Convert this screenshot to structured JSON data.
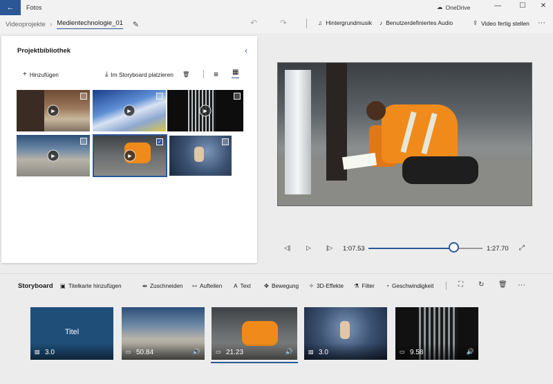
{
  "titlebar": {
    "app_title": "Fotos",
    "onedrive_label": "OneDrive",
    "minimize": "—",
    "maximize": "☐",
    "close": "✕",
    "back_icon": "←"
  },
  "navbar": {
    "breadcrumb_root": "Videoprojekte",
    "breadcrumb_separator": "›",
    "project_name": "Medientechnologie_01",
    "undo_icon": "↶",
    "redo_icon": "↷",
    "background_music": "Hintergrundmusik",
    "custom_audio": "Benutzerdefiniertes Audio",
    "finish_video": "Video fertig stellen",
    "more": "···"
  },
  "library": {
    "title": "Projektbibliothek",
    "collapse_icon": "‹",
    "add_label": "Hinzufügen",
    "place_in_storyboard": "Im Storyboard platzieren",
    "thumbnails": [
      {
        "kind": "video",
        "scene": "street-door",
        "selected": false
      },
      {
        "kind": "video",
        "scene": "blue-blur",
        "selected": false
      },
      {
        "kind": "video",
        "scene": "dark-gate",
        "selected": false
      },
      {
        "kind": "video",
        "scene": "stairs",
        "selected": false
      },
      {
        "kind": "video",
        "scene": "workers",
        "selected": true
      },
      {
        "kind": "image",
        "scene": "skater",
        "selected": false
      }
    ]
  },
  "playback": {
    "current_time": "1:07.53",
    "total_time": "1:27.70",
    "progress_fraction": 0.748
  },
  "storyboard": {
    "title": "Storyboard",
    "tools": {
      "title_card": "Titelkarte hinzufügen",
      "trim": "Zuschneiden",
      "split": "Aufteilen",
      "text": "Text",
      "motion": "Bewegung",
      "effects_3d": "3D-Effekte",
      "filters": "Filter",
      "speed": "Geschwindigkeit",
      "more": "···"
    },
    "clips": [
      {
        "kind": "title-card",
        "text": "Titel",
        "duration": "3.0",
        "audio": false,
        "selected": false
      },
      {
        "kind": "video",
        "duration": "50.84",
        "audio": true,
        "selected": false
      },
      {
        "kind": "video",
        "duration": "21.23",
        "audio": true,
        "selected": true
      },
      {
        "kind": "image",
        "duration": "3.0",
        "audio": false,
        "selected": false
      },
      {
        "kind": "video",
        "duration": "9.58",
        "audio": true,
        "selected": false
      }
    ]
  },
  "colors": {
    "accent": "#2b5797",
    "title_card_bg": "#1f4e79"
  }
}
